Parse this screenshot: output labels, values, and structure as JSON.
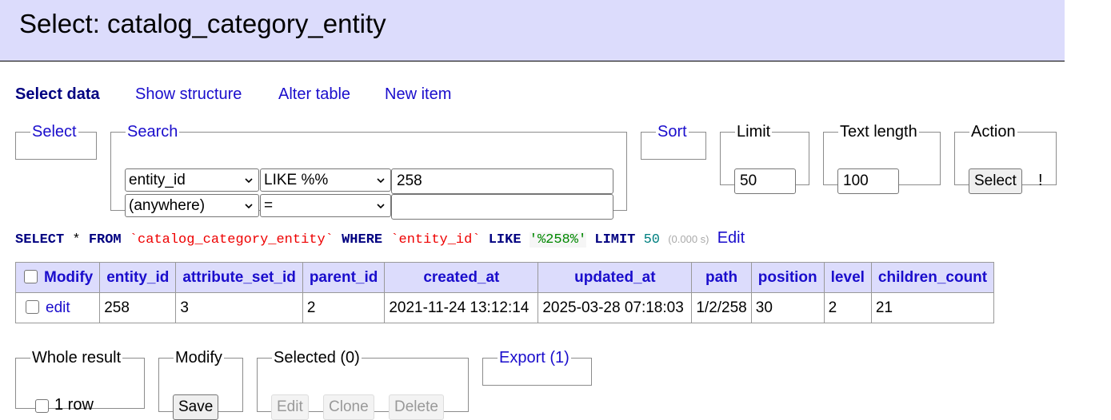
{
  "header": {
    "title": "Select: catalog_category_entity"
  },
  "menu": {
    "select_data": "Select data",
    "show_structure": "Show structure",
    "alter_table": "Alter table",
    "new_item": "New item"
  },
  "select_box": {
    "legend": "Select"
  },
  "search": {
    "legend": "Search",
    "rows": [
      {
        "column": "entity_id",
        "operator": "LIKE %%",
        "value": "258"
      },
      {
        "column": "(anywhere)",
        "operator": "=",
        "value": ""
      }
    ]
  },
  "sort": {
    "legend": "Sort"
  },
  "limit": {
    "legend": "Limit",
    "value": "50"
  },
  "text_length": {
    "legend": "Text length",
    "value": "100"
  },
  "action": {
    "legend": "Action",
    "button": "Select",
    "suffix": "!"
  },
  "sql": {
    "select": "SELECT",
    "star": " * ",
    "from": "FROM",
    "table": "`catalog_category_entity`",
    "where": "WHERE",
    "column": "`entity_id`",
    "like": "LIKE",
    "pattern": "'%258%'",
    "limit": "LIMIT",
    "limit_value": "50",
    "time": "(0.000 s)",
    "edit": "Edit"
  },
  "table": {
    "modify_header": "Modify",
    "columns": [
      "entity_id",
      "attribute_set_id",
      "parent_id",
      "created_at",
      "updated_at",
      "path",
      "position",
      "level",
      "children_count"
    ],
    "rows": [
      {
        "action": "edit",
        "cells": [
          "258",
          "3",
          "2",
          "2021-11-24 13:12:14",
          "2025-03-28 07:18:03",
          "1/2/258",
          "30",
          "2",
          "21"
        ]
      }
    ]
  },
  "whole_result": {
    "legend": "Whole result",
    "label": "1 row"
  },
  "modify": {
    "legend": "Modify",
    "save": "Save"
  },
  "selected": {
    "legend": "Selected (0)",
    "edit": "Edit",
    "clone": "Clone",
    "delete": "Delete"
  },
  "export": {
    "legend": "Export (1)"
  },
  "colors": {
    "header_bg": "#dcdcfc",
    "link": "#1a0dcc",
    "keyword": "#000080",
    "string": "#e00000",
    "literal": "#008000",
    "number": "#008080"
  }
}
